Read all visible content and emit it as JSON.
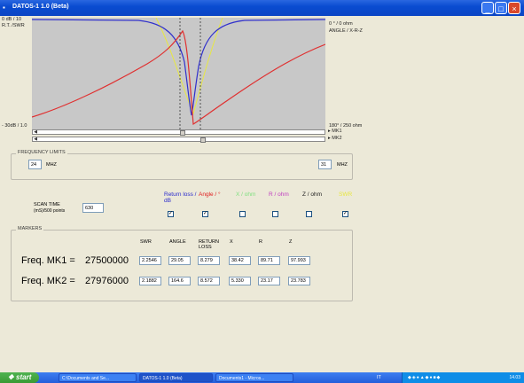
{
  "window": {
    "title": "DATOS-1 1.0 (Beta)"
  },
  "axes": {
    "left_top": "0 dB / 10",
    "left_top2": "R.T. /SWR",
    "left_bottom": "- 30dB / 1.0",
    "right_top": "0 ° / 0 ohm",
    "right_top2": "ANGLE / X-R-Z",
    "right_bottom": "180° / 250 ohm"
  },
  "sliders": {
    "mk1": "MK1",
    "mk2": "MK2"
  },
  "freq_limits": {
    "label": "FREQUENCY LIMITS",
    "low": "24",
    "high": "31",
    "unit": "MHZ"
  },
  "scan": {
    "label1": "SCAN TIME",
    "label2": "(mS)/500 points",
    "value": "630"
  },
  "series": [
    {
      "label": "Return loss / dB",
      "color": "#2a2acc",
      "checked": true
    },
    {
      "label": "Angle / °",
      "color": "#e02020",
      "checked": true
    },
    {
      "label": "X / ohm",
      "color": "#80e080",
      "checked": false
    },
    {
      "label": "R / ohm",
      "color": "#c040c0",
      "checked": false
    },
    {
      "label": "Z / ohm",
      "color": "#202020",
      "checked": false
    },
    {
      "label": "SWR",
      "color": "#e8e840",
      "checked": true
    }
  ],
  "markers": {
    "label": "MARKERS",
    "headers": [
      "SWR",
      "ANGLE",
      "RETURN\nLOSS",
      "X",
      "R",
      "Z"
    ],
    "rows": [
      {
        "label": "Freq. MK1 =",
        "freq": "27500000",
        "values": [
          "2.2546",
          "29.05",
          "8.279",
          "38.42",
          "89.71",
          "97.993"
        ]
      },
      {
        "label": "Freq. MK2 =",
        "freq": "27976000",
        "values": [
          "2.1882",
          "164.6",
          "8.572",
          "5.330",
          "23.17",
          "23.783"
        ]
      }
    ]
  },
  "taskbar": {
    "start": "start",
    "tasks": [
      "C:\\Documents and Se...",
      "DATOS-1 1.0 (Beta)",
      "Documents1 - Micros..."
    ],
    "lang": "IT",
    "clock": "14.03"
  }
}
